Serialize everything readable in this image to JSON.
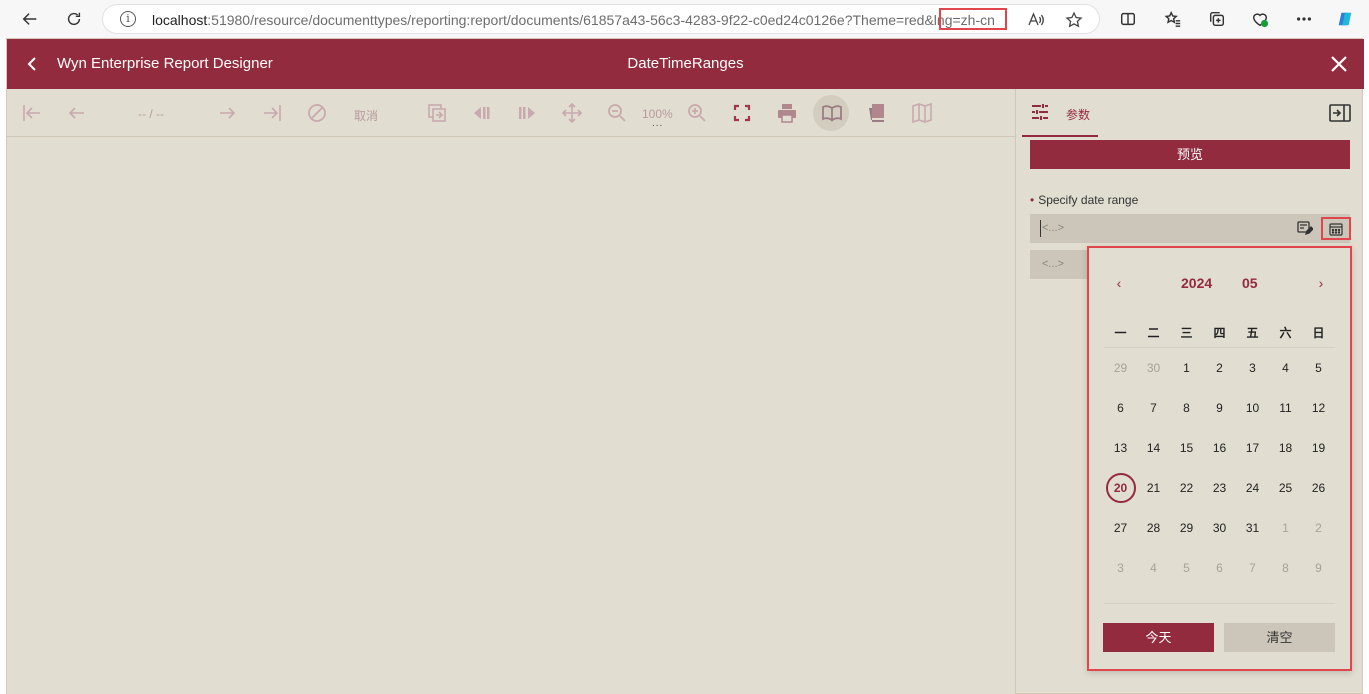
{
  "browser": {
    "url_host": "localhost",
    "url_rest": ":51980/resource/documenttypes/reporting:report/documents/61857a43-56c3-4283-9f22-c0ed24c0126e?Theme=red&lng=zh-cn",
    "icons": [
      "back-icon",
      "refresh-icon",
      "info-icon",
      "read-aloud-icon",
      "favorite-icon",
      "split-screen-icon",
      "favorites-icon",
      "collections-icon",
      "performance-icon",
      "more-icon",
      "copilot-icon"
    ]
  },
  "app": {
    "name": "Wyn Enterprise Report Designer",
    "document_title": "DateTimeRanges"
  },
  "toolbar": {
    "page_indicator": "-- / --",
    "cancel_label": "取消",
    "zoom_label": "100%",
    "zoom_dots": "..."
  },
  "panel": {
    "tab_label": "参数",
    "preview_label": "预览",
    "param_label": "Specify date range",
    "start_placeholder": "<...>",
    "end_placeholder": "<...>"
  },
  "calendar": {
    "year": "2024",
    "month": "05",
    "weekdays": [
      "一",
      "二",
      "三",
      "四",
      "五",
      "六",
      "日"
    ],
    "today_label": "今天",
    "clear_label": "清空",
    "selected_day": "20"
  },
  "colors": {
    "accent": "#922b3e",
    "background": "#e1ddd0",
    "highlight": "#e0464b"
  }
}
